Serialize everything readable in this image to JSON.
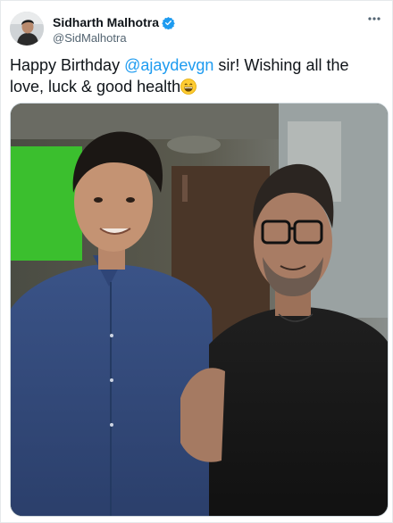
{
  "tweet": {
    "author": {
      "display_name": "Sidharth Malhotra",
      "handle": "@SidMalhotra",
      "verified": true,
      "avatar_icon": "avatar-photo"
    },
    "more_icon": "more-options-icon",
    "text": {
      "part1": "Happy Birthday ",
      "mention": "@ajaydevgn",
      "part2": " sir! Wishing all the love, luck & good health",
      "emoji": "grinning-face-emoji"
    },
    "media": {
      "kind": "photo",
      "alt_icon": "tweet-photo"
    }
  },
  "colors": {
    "link": "#1d9bf0",
    "verified": "#1d9bf0",
    "secondary_text": "#536471",
    "primary_text": "#0f1419"
  }
}
